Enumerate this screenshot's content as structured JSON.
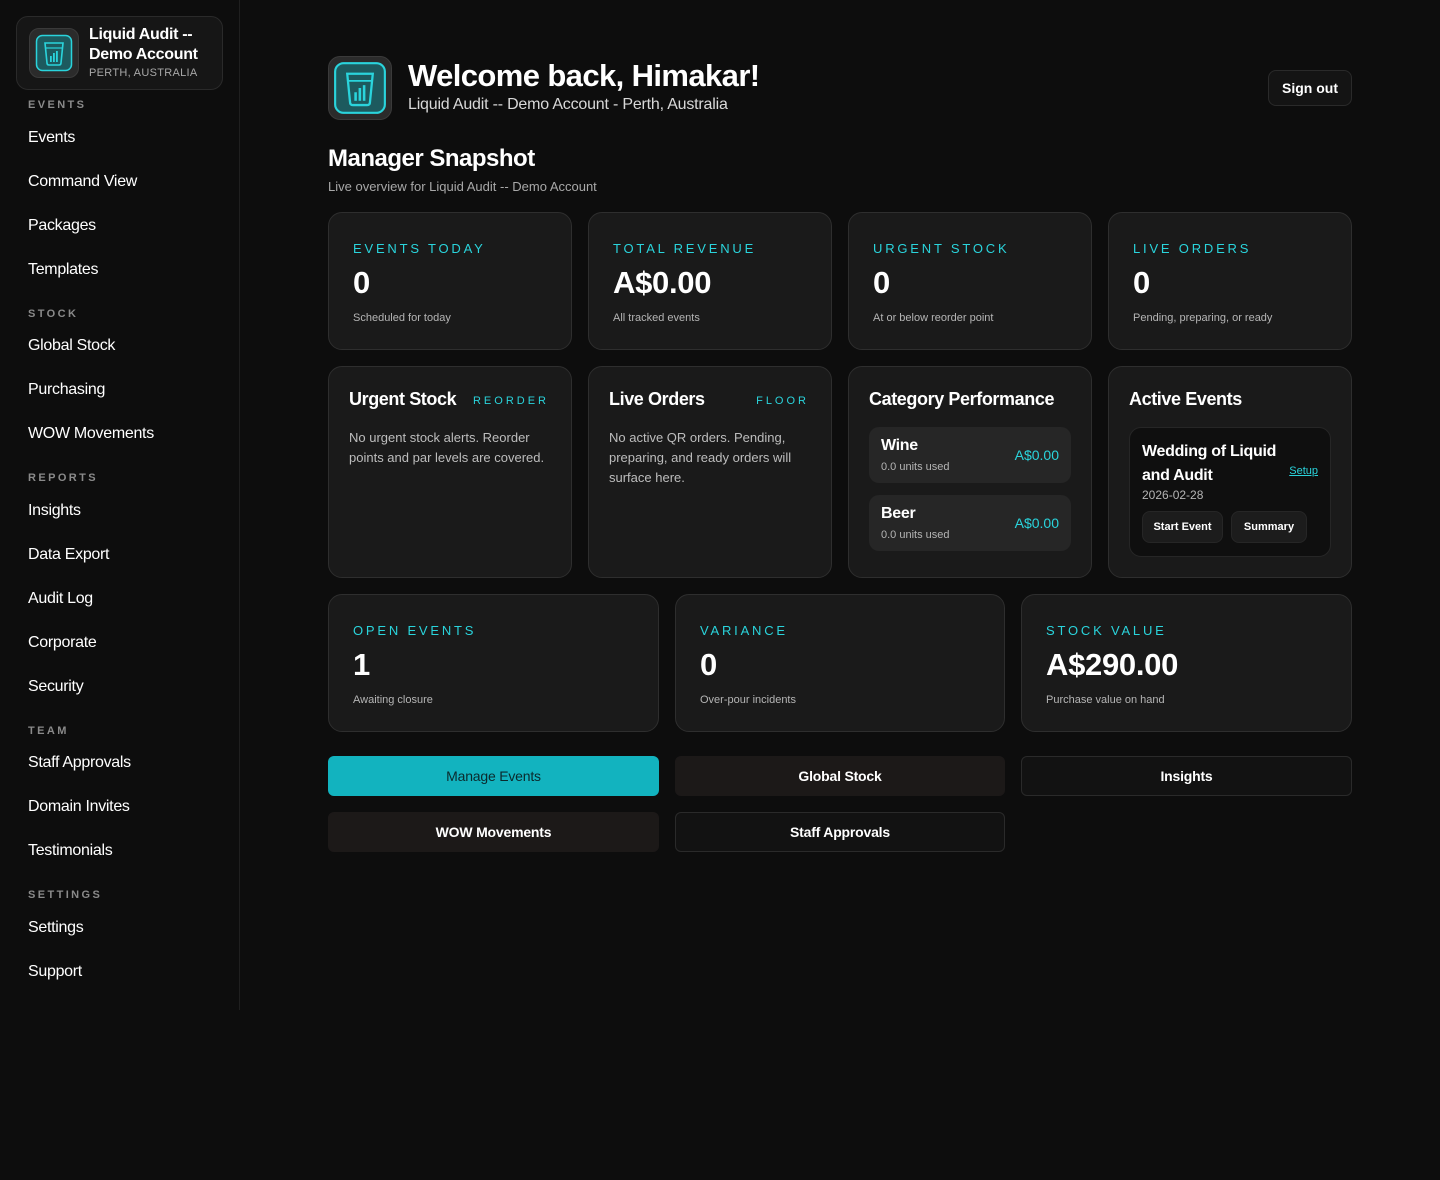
{
  "sidebar": {
    "brand_title": "Liquid Audit -- Demo Account",
    "brand_location": "PERTH, AUSTRALIA",
    "sections": {
      "events": "EVENTS",
      "stock": "STOCK",
      "reports": "REPORTS",
      "team": "TEAM",
      "settings": "SETTINGS"
    },
    "items": {
      "events": "Events",
      "command_view": "Command View",
      "packages": "Packages",
      "templates": "Templates",
      "global_stock": "Global Stock",
      "purchasing": "Purchasing",
      "wow_movements": "WOW Movements",
      "insights": "Insights",
      "data_export": "Data Export",
      "audit_log": "Audit Log",
      "corporate": "Corporate",
      "security": "Security",
      "staff_approvals": "Staff Approvals",
      "domain_invites": "Domain Invites",
      "testimonials": "Testimonials",
      "settings": "Settings",
      "support": "Support"
    }
  },
  "header": {
    "welcome": "Welcome back, Himakar!",
    "subtitle": "Liquid Audit -- Demo Account - Perth, Australia",
    "sign_out": "Sign out"
  },
  "snapshot": {
    "title": "Manager Snapshot",
    "subtitle": "Live overview for Liquid Audit -- Demo Account"
  },
  "kpis_top": [
    {
      "label": "EVENTS TODAY",
      "value": "0",
      "note": "Scheduled for today"
    },
    {
      "label": "TOTAL REVENUE",
      "value": "A$0.00",
      "note": "All tracked events"
    },
    {
      "label": "URGENT STOCK",
      "value": "0",
      "note": "At or below reorder point"
    },
    {
      "label": "LIVE ORDERS",
      "value": "0",
      "note": "Pending, preparing, or ready"
    }
  ],
  "panels": {
    "urgent_stock": {
      "title": "Urgent Stock",
      "tag": "REORDER",
      "text": "No urgent stock alerts. Reorder points and par levels are covered."
    },
    "live_orders": {
      "title": "Live Orders",
      "tag": "FLOOR",
      "text": "No active QR orders. Pending, preparing, and ready orders will surface here."
    },
    "category_performance": {
      "title": "Category Performance",
      "rows": [
        {
          "name": "Wine",
          "units": "0.0 units used",
          "value": "A$0.00"
        },
        {
          "name": "Beer",
          "units": "0.0 units used",
          "value": "A$0.00"
        }
      ]
    },
    "active_events": {
      "title": "Active Events",
      "event_name": "Wedding of Liquid and Audit",
      "setup_link": "Setup",
      "date": "2026-02-28",
      "start_button": "Start Event",
      "summary_button": "Summary"
    }
  },
  "kpis_bottom": [
    {
      "label": "OPEN EVENTS",
      "value": "1",
      "note": "Awaiting closure"
    },
    {
      "label": "VARIANCE",
      "value": "0",
      "note": "Over-pour incidents"
    },
    {
      "label": "STOCK VALUE",
      "value": "A$290.00",
      "note": "Purchase value on hand"
    }
  ],
  "actions": {
    "manage_events": "Manage Events",
    "global_stock": "Global Stock",
    "insights": "Insights",
    "wow_movements": "WOW Movements",
    "staff_approvals": "Staff Approvals"
  },
  "colors": {
    "accent": "#2ad4dc",
    "primary_button": "#12b3bf",
    "background": "#0d0d0d",
    "card": "#1a1a1a"
  },
  "icons": {
    "brand": "glass-chart-icon"
  }
}
